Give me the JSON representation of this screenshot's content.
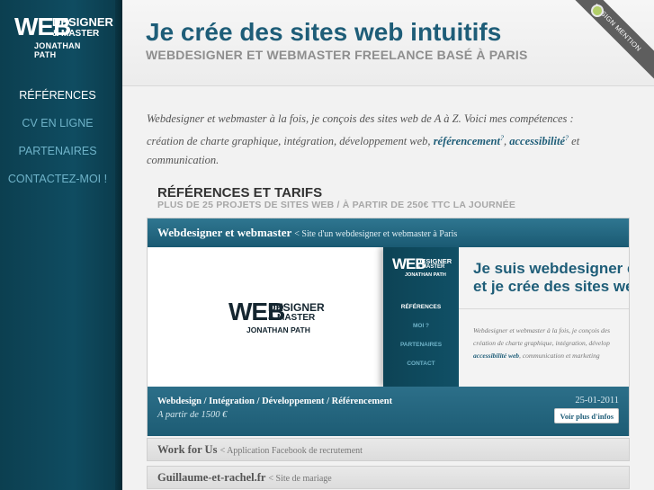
{
  "sidebar": {
    "logo": {
      "web": "WEB",
      "designer": "DESIGNER",
      "master": "& MASTER",
      "name": "JONATHAN PATH"
    },
    "nav": [
      {
        "label": "RÉFÉRENCES"
      },
      {
        "label": "CV EN LIGNE"
      },
      {
        "label": "PARTENAIRES"
      },
      {
        "label": "CONTACTEZ-MOI !"
      }
    ]
  },
  "header": {
    "title": "Je crée des sites web intuitifs",
    "subtitle": "WEBDESIGNER ET WEBMASTER FREELANCE BASÉ À PARIS",
    "ribbon": "DESIGN MENTION"
  },
  "intro": {
    "line1": "Webdesigner et webmaster à la fois, je conçois des sites web de A à Z. Voici mes compétences :",
    "line2_pre": "création de charte graphique, intégration, développement web, ",
    "link_seo": "référencement",
    "sup": "?",
    "comma": ", ",
    "link_a11y": "accessibilité",
    "line2_post": " et",
    "line3": "communication."
  },
  "section": {
    "title": "RÉFÉRENCES ET TARIFS",
    "subtitle": "PLUS DE 25 PROJETS DE SITES WEB / À PARTIR DE 250€ TTC LA JOURNÉE"
  },
  "project": {
    "title": "Webdesigner et webmaster",
    "desc": "< Site d'un webdesigner et webmaster à Paris",
    "preview": {
      "logo": {
        "web": "WEB",
        "designer": "DESIGNER",
        "master": "& MASTER",
        "name": "JONATHAN PATH"
      },
      "nav": [
        "RÉFÉRENCES",
        "MOI ?",
        "PARTENAIRES",
        "CONTACT"
      ],
      "headline1": "Je suis webdesigner et",
      "headline2": "et je crée des sites web",
      "text1": "Webdesigner et webmaster à la fois, je conçois des",
      "text2": "création de charte graphique, intégration, dévelop",
      "text3_link": "accessibilité web",
      "text3_rest": ", communication et marketing"
    },
    "tags": "Webdesign / Intégration / Développement / Référencement",
    "price": "A partir de 1500 €",
    "date": "25-01-2011",
    "button": "Voir plus d'infos"
  },
  "rows": [
    {
      "title": "Work for Us",
      "desc": "< Application Facebook de recrutement"
    },
    {
      "title": "Guillaume-et-rachel.fr",
      "desc": "< Site de mariage"
    }
  ]
}
